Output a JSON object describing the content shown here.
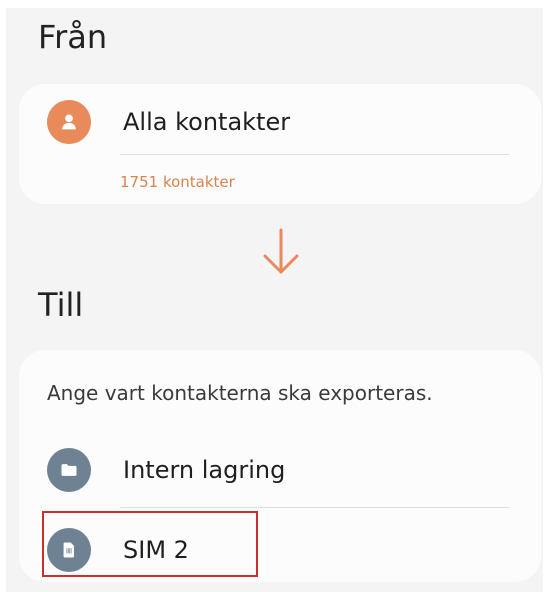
{
  "from": {
    "title": "Från",
    "source": {
      "label": "Alla kontakter",
      "count_text": "1751 kontakter",
      "icon": "person-icon"
    }
  },
  "direction": {
    "icon": "down-arrow-icon"
  },
  "to": {
    "title": "Till",
    "description": "Ange vart kontakterna ska exporteras.",
    "options": [
      {
        "label": "Intern lagring",
        "icon": "folder-icon"
      },
      {
        "label": "SIM 2",
        "icon": "sim-card-icon"
      }
    ]
  },
  "colors": {
    "accent": "#e98a5b",
    "icon_slate": "#6e8294",
    "highlight": "#cc2e2e",
    "background": "#f4f4f4"
  }
}
